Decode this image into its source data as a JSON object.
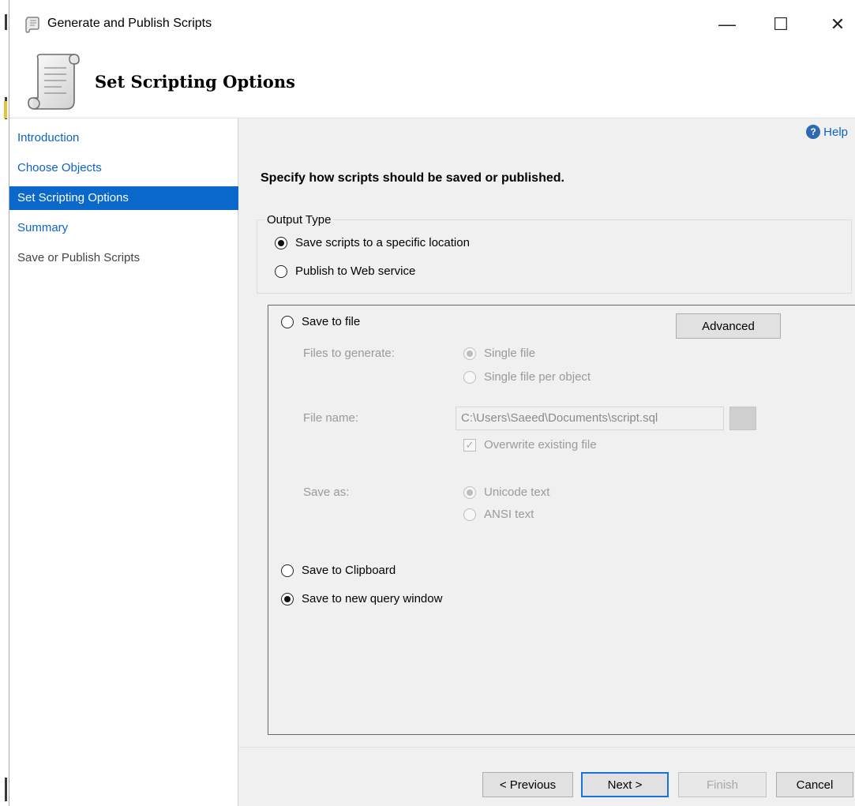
{
  "window": {
    "title": "Generate and Publish Scripts",
    "minimize_glyph": "—",
    "maximize_glyph": "☐",
    "close_glyph": "✕"
  },
  "header": {
    "title": "Set Scripting Options",
    "icon": "scroll-icon"
  },
  "sidebar": {
    "items": [
      {
        "label": "Introduction",
        "state": "link"
      },
      {
        "label": "Choose Objects",
        "state": "link"
      },
      {
        "label": "Set Scripting Options",
        "state": "active"
      },
      {
        "label": "Summary",
        "state": "link"
      },
      {
        "label": "Save or Publish Scripts",
        "state": "disabled"
      }
    ]
  },
  "help": {
    "label": "Help",
    "icon": "help-icon",
    "glyph": "?"
  },
  "main": {
    "instruction": "Specify how scripts should be saved or published.",
    "output_type": {
      "legend": "Output Type",
      "options": [
        {
          "label": "Save scripts to a specific location",
          "checked": true
        },
        {
          "label": "Publish to Web service",
          "checked": false
        }
      ]
    },
    "save_to_file": {
      "label": "Save to file",
      "checked": false,
      "advanced_label": "Advanced",
      "files_to_generate_label": "Files to generate:",
      "single_file_label": "Single file",
      "single_file_per_object_label": "Single file per object",
      "file_name_label": "File name:",
      "file_name_value": "C:\\Users\\Saeed\\Documents\\script.sql",
      "overwrite_label": "Overwrite existing file",
      "overwrite_checked": true,
      "check_glyph": "✓",
      "save_as_label": "Save as:",
      "unicode_label": "Unicode text",
      "ansi_label": "ANSI text"
    },
    "save_to_clipboard": {
      "label": "Save to Clipboard",
      "checked": false
    },
    "save_to_query_window": {
      "label": "Save to new query window",
      "checked": true
    }
  },
  "footer": {
    "previous_label": "< Previous",
    "next_label": "Next >",
    "finish_label": "Finish",
    "cancel_label": "Cancel"
  },
  "colors": {
    "accent": "#0a67cc",
    "link": "#0c63c4",
    "disabled_text": "#9a9a9a"
  }
}
